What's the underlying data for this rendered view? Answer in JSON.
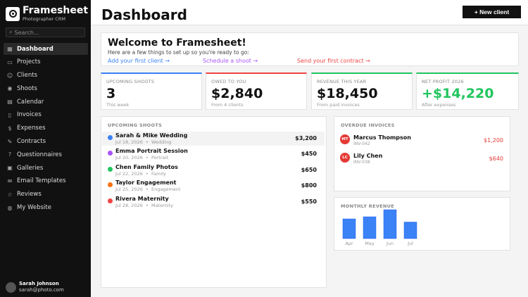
{
  "brand": {
    "name": "Framesheet",
    "subtitle": "Photographer CRM"
  },
  "search": {
    "placeholder": "Search..."
  },
  "nav": [
    {
      "label": "Dashboard",
      "icon": "dashboard-icon",
      "glyph": "▦",
      "active": true
    },
    {
      "label": "Projects",
      "icon": "folder-icon",
      "glyph": "▭"
    },
    {
      "label": "Clients",
      "icon": "users-icon",
      "glyph": "☺"
    },
    {
      "label": "Shoots",
      "icon": "camera-icon",
      "glyph": "◉"
    },
    {
      "label": "Calendar",
      "icon": "calendar-icon",
      "glyph": "▤"
    },
    {
      "label": "Invoices",
      "icon": "invoice-icon",
      "glyph": "▯"
    },
    {
      "label": "Expenses",
      "icon": "expense-icon",
      "glyph": "$"
    },
    {
      "label": "Contracts",
      "icon": "contract-icon",
      "glyph": "✎"
    },
    {
      "label": "Questionnaires",
      "icon": "questionnaire-icon",
      "glyph": "?"
    },
    {
      "label": "Galleries",
      "icon": "gallery-icon",
      "glyph": "▣"
    },
    {
      "label": "Email Templates",
      "icon": "email-icon",
      "glyph": "✉"
    },
    {
      "label": "Reviews",
      "icon": "star-icon",
      "glyph": "☆"
    },
    {
      "label": "My Website",
      "icon": "globe-icon",
      "glyph": "◍"
    }
  ],
  "user": {
    "name": "Sarah Johnson",
    "email": "sarah@photo.com"
  },
  "header": {
    "title": "Dashboard",
    "new_client_label": "+ New client"
  },
  "welcome": {
    "title": "Welcome to Framesheet! ",
    "subtitle": "Here are a few things to set up so you're ready to go:",
    "links": [
      {
        "label": "Add your first client →",
        "color": "#3b82f6"
      },
      {
        "label": "Schedule a shoot →",
        "color": "#a855f7"
      },
      {
        "label": "Send your first contract →",
        "color": "#ef4444"
      }
    ]
  },
  "stats": [
    {
      "label": "UPCOMING SHOOTS",
      "value": "3",
      "note": "This week",
      "accent": "#3b82f6",
      "value_color": "#111111"
    },
    {
      "label": "OWED TO YOU",
      "value": "$2,840",
      "note": "From 4 clients",
      "accent": "#ef4444",
      "value_color": "#111111"
    },
    {
      "label": "REVENUE THIS YEAR",
      "value": "$18,450",
      "note": "From paid invoices",
      "accent": "#22c55e",
      "value_color": "#111111"
    },
    {
      "label": "NET PROFIT 2026",
      "value": "+$14,220",
      "note": "After expenses",
      "accent": "#22c55e",
      "value_color": "#22c55e"
    }
  ],
  "upcoming": {
    "title": "UPCOMING SHOOTS",
    "items": [
      {
        "title": "Sarah & Mike Wedding",
        "date": "Jul 18, 2026",
        "type": "Wedding",
        "price": "$3,200",
        "color": "#3b82f6"
      },
      {
        "title": "Emma Portrait Session",
        "date": "Jul 20, 2026",
        "type": "Portrait",
        "price": "$450",
        "color": "#a855f7"
      },
      {
        "title": "Chen Family Photos",
        "date": "Jul 22, 2026",
        "type": "Family",
        "price": "$650",
        "color": "#22c55e"
      },
      {
        "title": "Taylor Engagement",
        "date": "Jul 25, 2026",
        "type": "Engagement",
        "price": "$800",
        "color": "#f97316"
      },
      {
        "title": "Rivera Maternity",
        "date": "Jul 28, 2026",
        "type": "Maternity",
        "price": "$550",
        "color": "#ef4444"
      }
    ]
  },
  "overdue": {
    "title": "OVERDUE INVOICES",
    "items": [
      {
        "initials": "MT",
        "name": "Marcus Thompson",
        "invoice": "INV-042",
        "amount": "$1,200"
      },
      {
        "initials": "LC",
        "name": "Lily Chen",
        "invoice": "INV-038",
        "amount": "$640"
      }
    ]
  },
  "revenue_chart": {
    "title": "MONTHLY REVENUE",
    "chart_data": {
      "type": "bar",
      "categories": [
        "Apr",
        "May",
        "Jun",
        "Jul"
      ],
      "values": [
        0.56,
        0.62,
        0.82,
        0.47
      ],
      "bar_color": "#3b82f6"
    }
  }
}
